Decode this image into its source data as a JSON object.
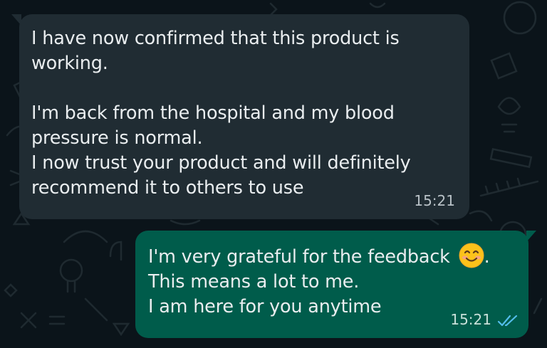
{
  "colors": {
    "background": "#0b141a",
    "incoming_bubble": "#202c33",
    "outgoing_bubble": "#005c4b",
    "text": "#e9edef",
    "read_ticks": "#53bdeb"
  },
  "messages": [
    {
      "direction": "incoming",
      "lines": [
        "I have now confirmed that this product is",
        "working.",
        "",
        "I'm back from the hospital and my blood",
        "pressure is normal.",
        "I now trust your product and will definitely",
        "recommend it to others to use"
      ],
      "time": "15:21"
    },
    {
      "direction": "outgoing",
      "lines": [
        "I'm very grateful for the feedback",
        "This means a lot to me.",
        "I am here for you anytime"
      ],
      "line1_suffix": ".",
      "emoji": "smiling-face-emoji",
      "time": "15:21",
      "status": "read",
      "status_icon": "double-check-icon"
    }
  ]
}
